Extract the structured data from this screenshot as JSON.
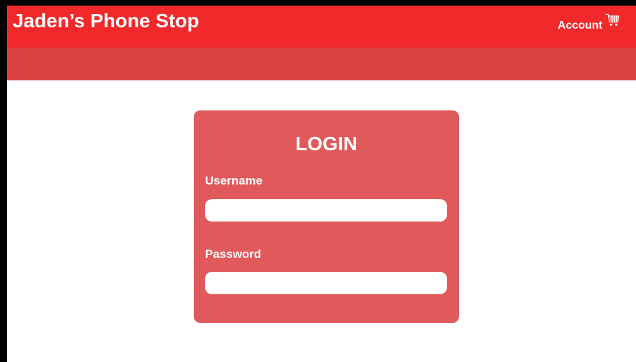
{
  "colors": {
    "header_bg": "#f2292a",
    "subnav_bg": "#db4343",
    "card_bg": "#e05a5b",
    "text": "#ffffff",
    "page_bg": "#ffffff"
  },
  "header": {
    "brand": "Jaden’s Phone Stop",
    "account_label": "Account",
    "cart_icon": "shopping-cart-icon"
  },
  "login": {
    "title": "LOGIN",
    "username_label": "Username",
    "username_value": "",
    "password_label": "Password",
    "password_value": ""
  }
}
